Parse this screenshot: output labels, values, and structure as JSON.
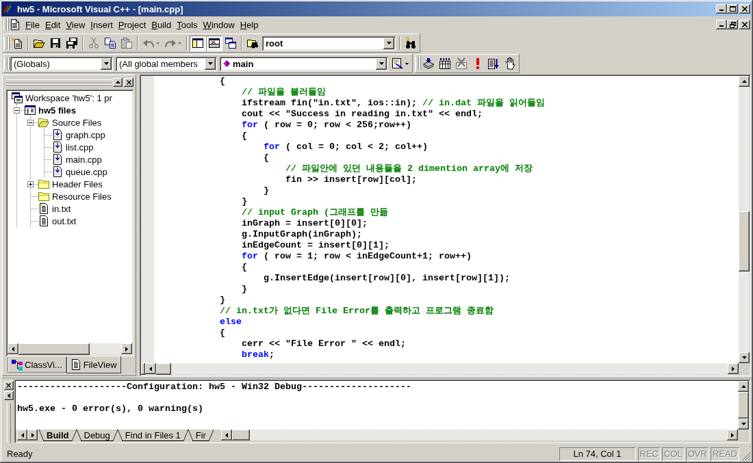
{
  "window": {
    "title": "hw5 - Microsoft Visual C++ - [main.cpp]"
  },
  "menu": [
    "File",
    "Edit",
    "View",
    "Insert",
    "Project",
    "Build",
    "Tools",
    "Window",
    "Help"
  ],
  "toolbar_rows": [
    {
      "toolbars": [
        {
          "items": [
            {
              "kind": "new",
              "disabled": false,
              "pressed": false
            },
            {
              "kind": "separator"
            },
            {
              "kind": "open",
              "disabled": false,
              "pressed": false
            },
            {
              "kind": "save",
              "disabled": false,
              "pressed": false
            },
            {
              "kind": "saveall",
              "disabled": false,
              "pressed": false
            },
            {
              "kind": "separator"
            },
            {
              "kind": "cut",
              "disabled": true,
              "pressed": false
            },
            {
              "kind": "copy",
              "disabled": false,
              "pressed": false
            },
            {
              "kind": "paste",
              "disabled": true,
              "pressed": false
            },
            {
              "kind": "separator"
            },
            {
              "kind": "undo",
              "disabled": true,
              "pressed": false
            },
            {
              "kind": "redo",
              "disabled": true,
              "pressed": false
            },
            {
              "kind": "separator"
            },
            {
              "kind": "workspace",
              "disabled": false,
              "pressed": true
            },
            {
              "kind": "output",
              "disabled": false,
              "pressed": true
            },
            {
              "kind": "windows",
              "disabled": false,
              "pressed": false
            },
            {
              "kind": "separator"
            },
            {
              "kind": "findfiles",
              "disabled": false,
              "pressed": false
            },
            {
              "kind": "findcombo",
              "value": "root"
            },
            {
              "kind": "separator"
            },
            {
              "kind": "find",
              "disabled": false,
              "pressed": false
            }
          ]
        }
      ]
    },
    {
      "toolbars": [
        {
          "items": [
            {
              "kind": "classcombo",
              "value": "(Globals)"
            },
            {
              "kind": "filtercombo",
              "value": "(All global members"
            },
            {
              "kind": "membercombo",
              "value": "main"
            },
            {
              "kind": "wizard",
              "disabled": false,
              "pressed": false
            }
          ]
        },
        {
          "items": [
            {
              "kind": "compile",
              "disabled": false,
              "pressed": false
            },
            {
              "kind": "build",
              "disabled": false,
              "pressed": false
            },
            {
              "kind": "stopbuild",
              "disabled": true,
              "pressed": false
            },
            {
              "kind": "execute",
              "disabled": false,
              "pressed": false
            },
            {
              "kind": "go",
              "disabled": false,
              "pressed": false
            },
            {
              "kind": "breakpoint",
              "disabled": false,
              "pressed": false
            }
          ]
        }
      ]
    }
  ],
  "workspace": {
    "tree": {
      "label": "Workspace 'hw5': 1 pr",
      "kind": "workspace",
      "children": [
        {
          "label": "hw5 files",
          "kind": "project",
          "expanded": true,
          "children": [
            {
              "label": "Source Files",
              "kind": "folder",
              "expanded": true,
              "children": [
                {
                  "label": "graph.cpp",
                  "kind": "source"
                },
                {
                  "label": "list.cpp",
                  "kind": "source"
                },
                {
                  "label": "main.cpp",
                  "kind": "source"
                },
                {
                  "label": "queue.cpp",
                  "kind": "source"
                }
              ]
            },
            {
              "label": "Header Files",
              "kind": "folder",
              "expanded": false
            },
            {
              "label": "Resource Files",
              "kind": "folder"
            },
            {
              "label": "in.txt",
              "kind": "text"
            },
            {
              "label": "out.txt",
              "kind": "text"
            }
          ]
        }
      ]
    },
    "tabs": [
      {
        "label": "ClassVi...",
        "kind": "class",
        "selected": false
      },
      {
        "label": "FileView",
        "kind": "file",
        "selected": true
      }
    ]
  },
  "editor": {
    "lines": [
      [
        {
          "kind": "plain",
          "text": "            {"
        }
      ],
      [
        {
          "kind": "comment",
          "text": "                // 파일을 불러들임"
        }
      ],
      [
        {
          "kind": "plain",
          "text": "                ifstream fin(\"in.txt\", ios::in); "
        },
        {
          "kind": "comment",
          "text": "// in.dat 파일을 읽어들임"
        }
      ],
      [
        {
          "kind": "plain",
          "text": "                cout << \"Success in reading in.txt\" << endl;"
        }
      ],
      [
        {
          "kind": "keyword",
          "text": "                for"
        },
        {
          "kind": "plain",
          "text": " ( row = 0; row < 256;row++)"
        }
      ],
      [
        {
          "kind": "plain",
          "text": "                {"
        }
      ],
      [
        {
          "kind": "keyword",
          "text": "                    for"
        },
        {
          "kind": "plain",
          "text": " ( col = 0; col < 2; col++)"
        }
      ],
      [
        {
          "kind": "plain",
          "text": "                    {"
        }
      ],
      [
        {
          "kind": "comment",
          "text": "                        // 파일안에 있던 내용들을 2 dimention array에 저장"
        }
      ],
      [
        {
          "kind": "plain",
          "text": "                        fin >> insert[row][col];"
        }
      ],
      [
        {
          "kind": "plain",
          "text": "                    }"
        }
      ],
      [
        {
          "kind": "plain",
          "text": "                }"
        }
      ],
      [
        {
          "kind": "comment",
          "text": "                // input Graph (그래프를 만듦"
        }
      ],
      [
        {
          "kind": "plain",
          "text": "                inGraph = insert[0][0];"
        }
      ],
      [
        {
          "kind": "plain",
          "text": "                g.InputGraph(inGraph);"
        }
      ],
      [
        {
          "kind": "plain",
          "text": "                inEdgeCount = insert[0][1];"
        }
      ],
      [
        {
          "kind": "keyword",
          "text": "                for"
        },
        {
          "kind": "plain",
          "text": " ( row = 1; row < inEdgeCount+1; row++)"
        }
      ],
      [
        {
          "kind": "plain",
          "text": "                {"
        }
      ],
      [
        {
          "kind": "plain",
          "text": "                    g.InsertEdge(insert[row][0], insert[row][1]);"
        }
      ],
      [
        {
          "kind": "plain",
          "text": "                }"
        }
      ],
      [
        {
          "kind": "plain",
          "text": "            }"
        }
      ],
      [
        {
          "kind": "comment",
          "text": "            // in.txt가 없다면 File Error를 출력하고 프로그램 종료함"
        }
      ],
      [
        {
          "kind": "keyword",
          "text": "            else"
        }
      ],
      [
        {
          "kind": "plain",
          "text": "            {"
        }
      ],
      [
        {
          "kind": "plain",
          "text": "                cerr << \"File Error \" << endl;"
        }
      ],
      [
        {
          "kind": "keyword",
          "text": "                break"
        },
        {
          "kind": "plain",
          "text": ";"
        }
      ]
    ]
  },
  "output": {
    "lines": [
      "--------------------Configuration: hw5 - Win32 Debug--------------------",
      "hw5.exe - 0 error(s), 0 warning(s)"
    ],
    "tabs": [
      {
        "label": "Build",
        "selected": true
      },
      {
        "label": "Debug",
        "selected": false
      },
      {
        "label": "Find in Files 1",
        "selected": false
      },
      {
        "label": "Fir",
        "selected": false
      }
    ]
  },
  "status_bar": {
    "message": "Ready",
    "position": "Ln 74, Col 1",
    "indicators": [
      {
        "label": "REC",
        "on": false
      },
      {
        "label": "COL",
        "on": false
      },
      {
        "label": "OVR",
        "on": false
      },
      {
        "label": "READ",
        "on": false
      }
    ]
  }
}
